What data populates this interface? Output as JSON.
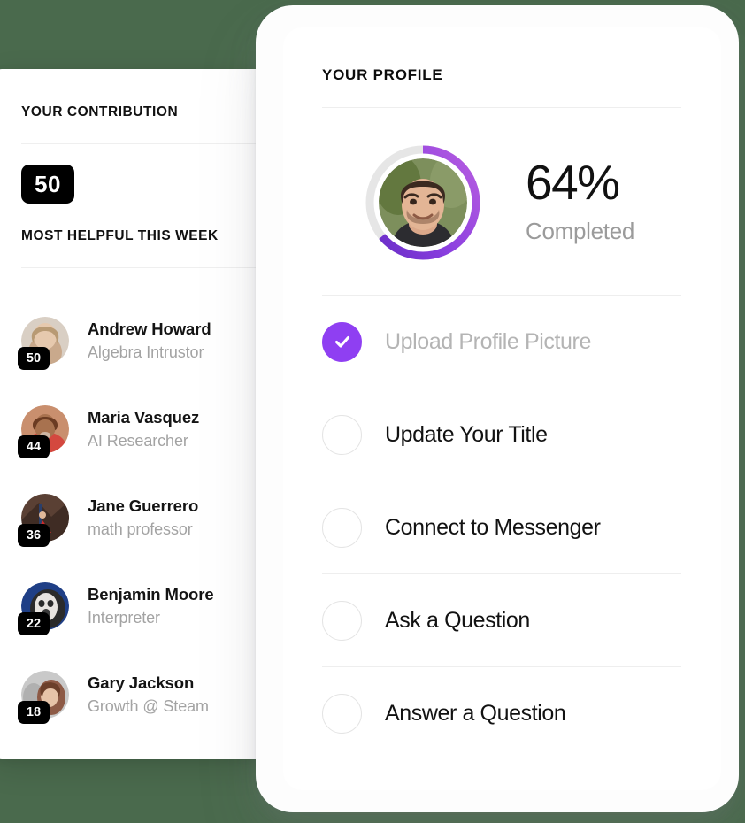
{
  "theme": {
    "background_color": "#4a6a4d",
    "accent_purple": "#8f3ff2",
    "ring_gradient_start": "#6a2ec7",
    "ring_gradient_end": "#b35ae0",
    "badge_black": "#000000",
    "muted_text": "#a3a3a3"
  },
  "contribution_card": {
    "section_title": "YOUR CONTRIBUTION",
    "score": "50",
    "most_helpful_title": "MOST HELPFUL THIS WEEK",
    "people": [
      {
        "name": "Andrew Howard",
        "title": "Algebra Intrustor",
        "rank": "50",
        "avatar_icon": "avatar-andrew-howard"
      },
      {
        "name": "Maria Vasquez",
        "title": "AI Researcher",
        "rank": "44",
        "avatar_icon": "avatar-maria-vasquez"
      },
      {
        "name": "Jane Guerrero",
        "title": "math professor",
        "rank": "36",
        "avatar_icon": "avatar-jane-guerrero"
      },
      {
        "name": "Benjamin Moore",
        "title": "Interpreter",
        "rank": "22",
        "avatar_icon": "avatar-benjamin-moore"
      },
      {
        "name": "Gary Jackson",
        "title": "Growth @ Steam",
        "rank": "18",
        "avatar_icon": "avatar-gary-jackson"
      }
    ]
  },
  "profile_card": {
    "section_title": "YOUR PROFILE",
    "progress": {
      "percent_label": "64%",
      "percent_value": 64,
      "completed_label": "Completed",
      "avatar_icon": "avatar-current-user"
    },
    "checklist": [
      {
        "label": "Upload Profile Picture",
        "done": true,
        "icon": "check-icon"
      },
      {
        "label": "Update Your Title",
        "done": false,
        "icon": "empty-circle-icon"
      },
      {
        "label": "Connect to Messenger",
        "done": false,
        "icon": "empty-circle-icon"
      },
      {
        "label": "Ask a Question",
        "done": false,
        "icon": "empty-circle-icon"
      },
      {
        "label": "Answer a Question",
        "done": false,
        "icon": "empty-circle-icon"
      }
    ]
  }
}
